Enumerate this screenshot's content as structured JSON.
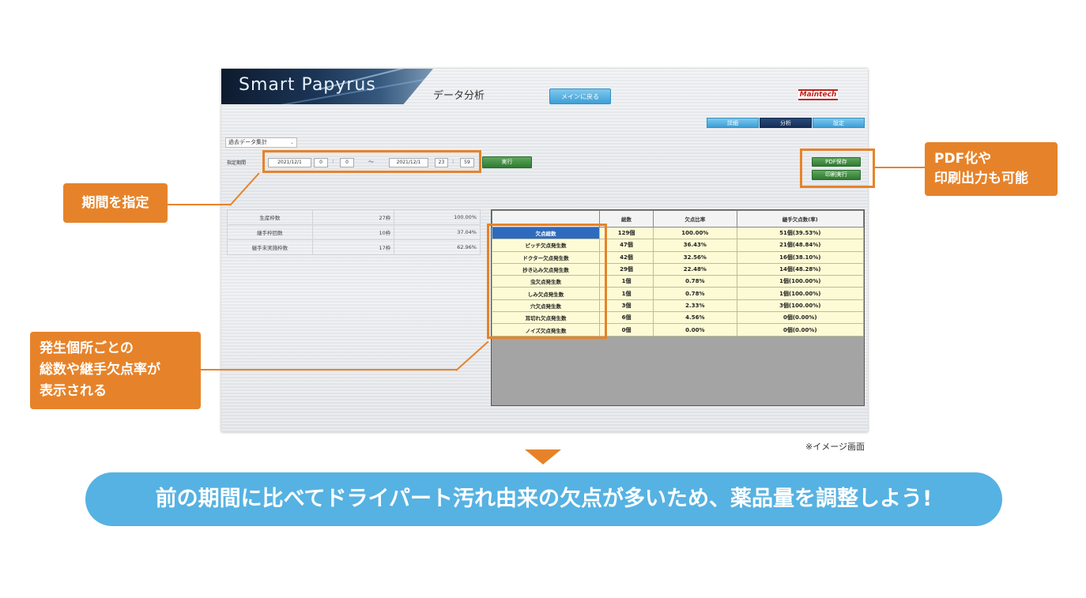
{
  "app": {
    "brand": "Smart Papyrus",
    "page_title": "データ分析",
    "back_button": "メインに戻る",
    "company_logo": "Maintech"
  },
  "tabs": [
    {
      "label": "詳細",
      "active": false
    },
    {
      "label": "分析",
      "active": true
    },
    {
      "label": "設定",
      "active": false
    }
  ],
  "filter": {
    "mode_select": "過去データ集計",
    "period_label": "指定期間",
    "start_date": "2021/12/1",
    "start_hour": "0",
    "start_min": "0",
    "tilde": "～",
    "end_date": "2021/12/1",
    "end_hour": "23",
    "end_min": "59",
    "colon": ":",
    "run_button": "実行"
  },
  "export": {
    "pdf_button": "PDF保存",
    "print_button": "印刷実行"
  },
  "summary": [
    {
      "label": "生産枠数",
      "value": "27枠",
      "ratio": "100.00%"
    },
    {
      "label": "継手枠回数",
      "value": "10枠",
      "ratio": "37.04%"
    },
    {
      "label": "継手未実施枠数",
      "value": "17枠",
      "ratio": "62.96%"
    }
  ],
  "defect_table": {
    "headers": [
      "",
      "総数",
      "欠点比率",
      "継手欠点数(率)"
    ],
    "rows": [
      {
        "name": "欠点総数",
        "total": "129個",
        "ratio": "100.00%",
        "joint": "51個(39.53%)",
        "selected": true
      },
      {
        "name": "ピッチ欠点発生数",
        "total": "47個",
        "ratio": "36.43%",
        "joint": "21個(48.84%)"
      },
      {
        "name": "ドクター欠点発生数",
        "total": "42個",
        "ratio": "32.56%",
        "joint": "16個(38.10%)"
      },
      {
        "name": "抄き込み欠点発生数",
        "total": "29個",
        "ratio": "22.48%",
        "joint": "14個(48.28%)"
      },
      {
        "name": "虫欠点発生数",
        "total": "1個",
        "ratio": "0.78%",
        "joint": "1個(100.00%)"
      },
      {
        "name": "しみ欠点発生数",
        "total": "1個",
        "ratio": "0.78%",
        "joint": "1個(100.00%)"
      },
      {
        "name": "穴欠点発生数",
        "total": "3個",
        "ratio": "2.33%",
        "joint": "3個(100.00%)"
      },
      {
        "name": "耳切れ欠点発生数",
        "total": "6個",
        "ratio": "4.56%",
        "joint": "0個(0.00%)"
      },
      {
        "name": "ノイズ欠点発生数",
        "total": "0個",
        "ratio": "0.00%",
        "joint": "0個(0.00%)"
      }
    ]
  },
  "callouts": {
    "period": "期間を指定",
    "pdf": [
      "PDF化や",
      "印刷出力も可能"
    ],
    "totals": [
      "発生個所ごとの",
      "総数や継手欠点率が",
      "表示される"
    ]
  },
  "image_note": "※イメージ画面",
  "banner": "前の期間に比べてドライパート汚れ由来の欠点が多いため、薬品量を調整しよう!",
  "colors": {
    "accent_orange": "#e6832a",
    "banner_blue": "#56b2e2",
    "selected_row": "#2f6bbd",
    "button_green": "#2f7a33"
  }
}
